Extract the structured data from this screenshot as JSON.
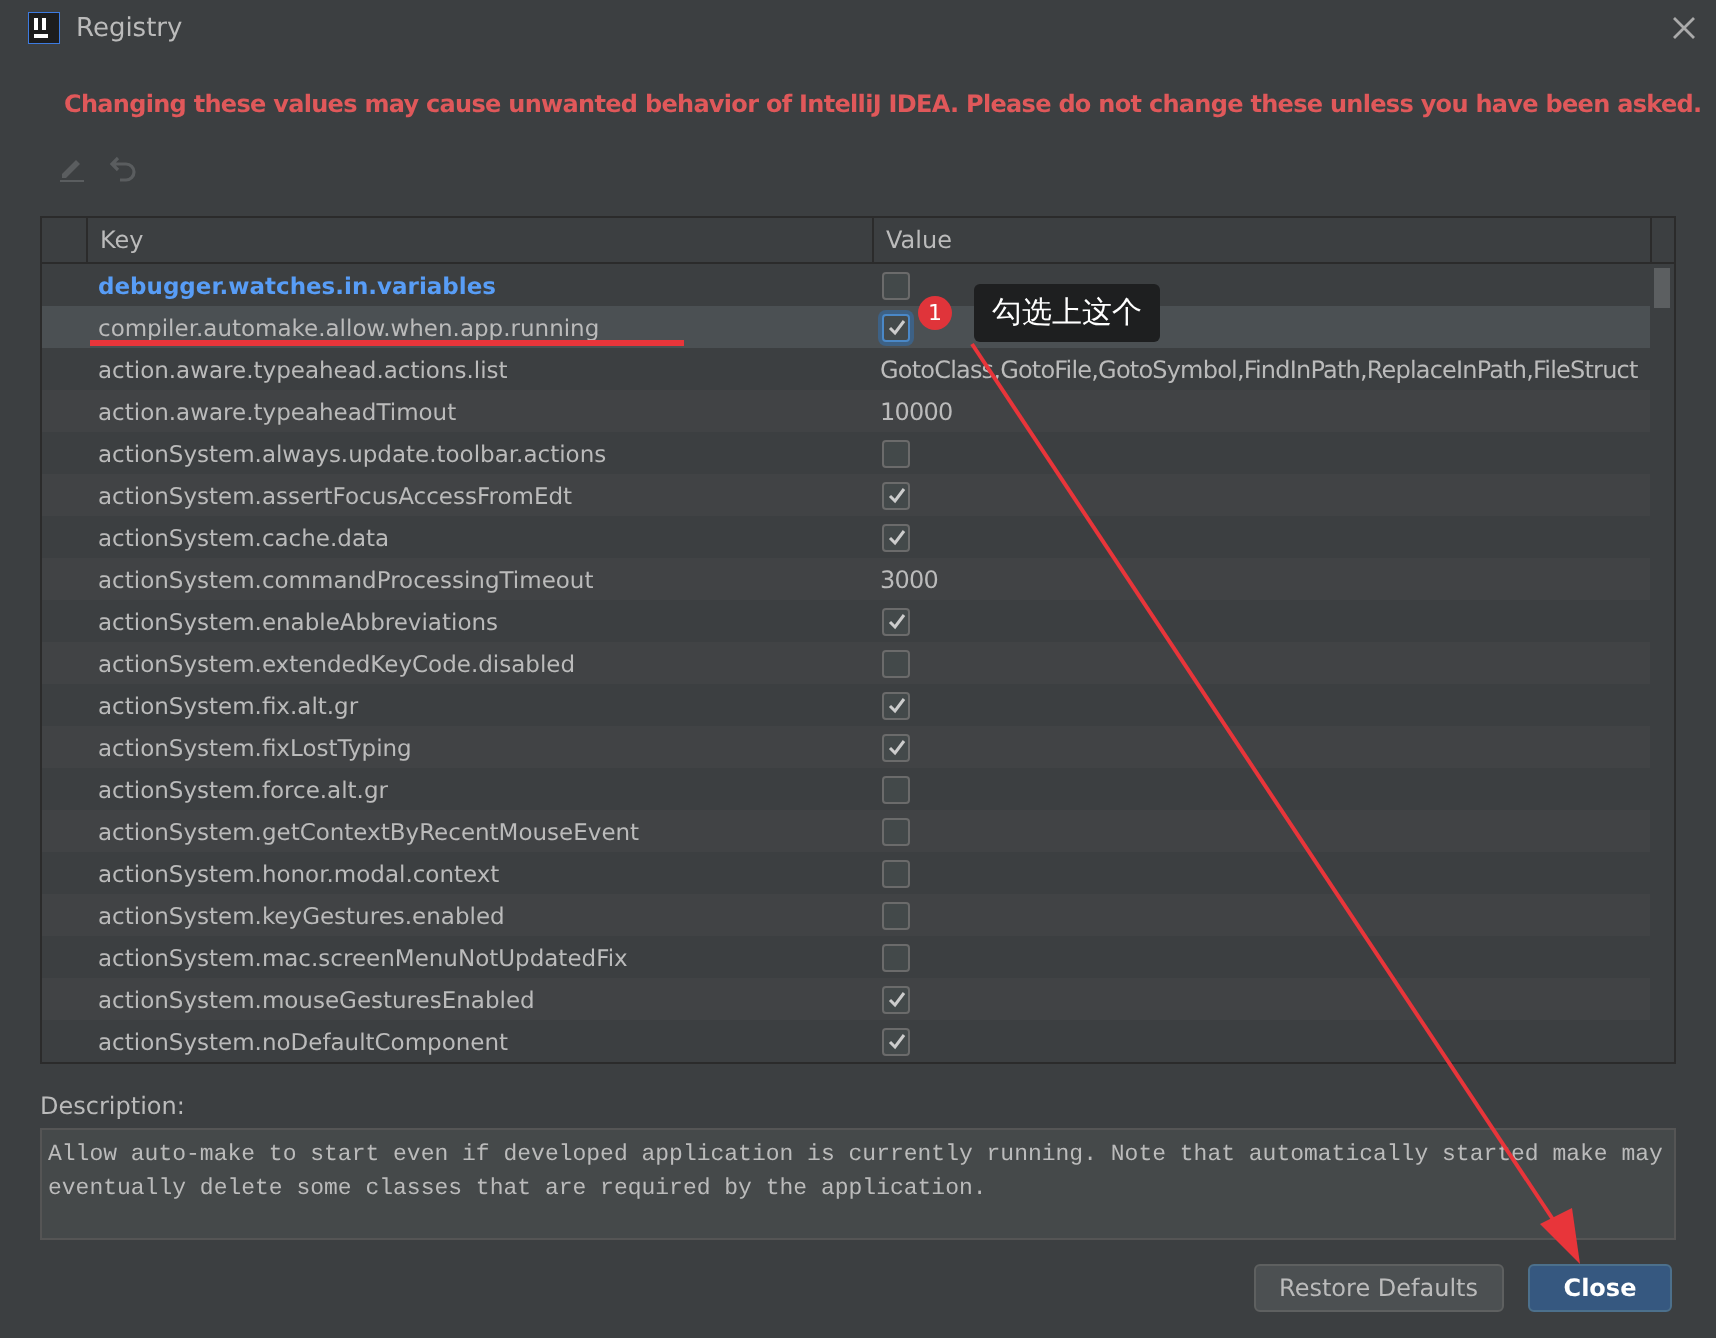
{
  "window": {
    "title": "Registry"
  },
  "warning": "Changing these values may cause unwanted behavior of IntelliJ IDEA. Please do not change these unless you have been asked.",
  "toolbar": [
    {
      "kind": "edit",
      "disabled": true
    },
    {
      "kind": "revert",
      "disabled": true
    }
  ],
  "table": {
    "columns": [
      "Key",
      "Value"
    ],
    "rows": [
      {
        "key": "debugger.watches.in.variables",
        "kind": "checkbox",
        "checked": false,
        "modified": true,
        "selected": false
      },
      {
        "key": "compiler.automake.allow.when.app.running",
        "kind": "checkbox",
        "checked": true,
        "modified": false,
        "selected": true
      },
      {
        "key": "action.aware.typeahead.actions.list",
        "kind": "text",
        "value": "GotoClass,GotoFile,GotoSymbol,FindInPath,ReplaceInPath,FileStruct",
        "modified": false,
        "selected": false
      },
      {
        "key": "action.aware.typeaheadTimout",
        "kind": "text",
        "value": "10000",
        "modified": false,
        "selected": false
      },
      {
        "key": "actionSystem.always.update.toolbar.actions",
        "kind": "checkbox",
        "checked": false,
        "modified": false,
        "selected": false
      },
      {
        "key": "actionSystem.assertFocusAccessFromEdt",
        "kind": "checkbox",
        "checked": true,
        "modified": false,
        "selected": false
      },
      {
        "key": "actionSystem.cache.data",
        "kind": "checkbox",
        "checked": true,
        "modified": false,
        "selected": false
      },
      {
        "key": "actionSystem.commandProcessingTimeout",
        "kind": "text",
        "value": "3000",
        "modified": false,
        "selected": false
      },
      {
        "key": "actionSystem.enableAbbreviations",
        "kind": "checkbox",
        "checked": true,
        "modified": false,
        "selected": false
      },
      {
        "key": "actionSystem.extendedKeyCode.disabled",
        "kind": "checkbox",
        "checked": false,
        "modified": false,
        "selected": false
      },
      {
        "key": "actionSystem.fix.alt.gr",
        "kind": "checkbox",
        "checked": true,
        "modified": false,
        "selected": false
      },
      {
        "key": "actionSystem.fixLostTyping",
        "kind": "checkbox",
        "checked": true,
        "modified": false,
        "selected": false
      },
      {
        "key": "actionSystem.force.alt.gr",
        "kind": "checkbox",
        "checked": false,
        "modified": false,
        "selected": false
      },
      {
        "key": "actionSystem.getContextByRecentMouseEvent",
        "kind": "checkbox",
        "checked": false,
        "modified": false,
        "selected": false
      },
      {
        "key": "actionSystem.honor.modal.context",
        "kind": "checkbox",
        "checked": false,
        "modified": false,
        "selected": false
      },
      {
        "key": "actionSystem.keyGestures.enabled",
        "kind": "checkbox",
        "checked": false,
        "modified": false,
        "selected": false
      },
      {
        "key": "actionSystem.mac.screenMenuNotUpdatedFix",
        "kind": "checkbox",
        "checked": false,
        "modified": false,
        "selected": false
      },
      {
        "key": "actionSystem.mouseGesturesEnabled",
        "kind": "checkbox",
        "checked": true,
        "modified": false,
        "selected": false
      },
      {
        "key": "actionSystem.noDefaultComponent",
        "kind": "checkbox",
        "checked": true,
        "modified": false,
        "selected": false
      }
    ]
  },
  "description": {
    "label": "Description:",
    "text": "Allow auto-make to start even if developed application is currently running. Note that automatically started make may eventually delete some classes that are required by the application."
  },
  "buttons": [
    {
      "label": "Restore Defaults",
      "primary": false
    },
    {
      "label": "Close",
      "primary": true
    }
  ],
  "annotation": {
    "badge": "1",
    "note": "勾选上这个"
  }
}
